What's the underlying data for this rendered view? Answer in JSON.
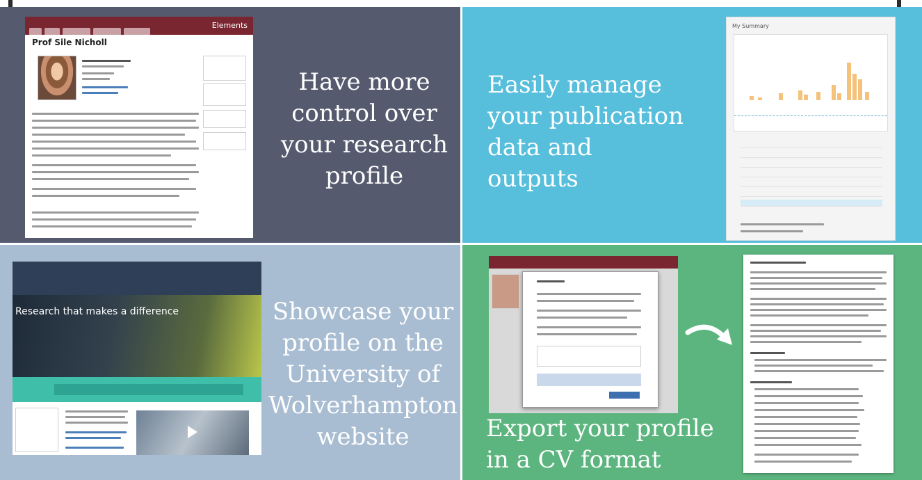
{
  "panels": {
    "control": {
      "caption": [
        "Have more",
        "control over",
        "your research",
        "profile"
      ],
      "screenshot": {
        "brand": "Elements",
        "profile_name": "Prof Sile Nicholl"
      }
    },
    "manage": {
      "caption": [
        "Easily manage",
        "your publication",
        "data and",
        "outputs"
      ],
      "screenshot": {
        "title": "My Summary"
      }
    },
    "showcase": {
      "caption": [
        "Showcase your",
        "profile on the",
        "University of",
        "Wolverhampton",
        "website"
      ],
      "screenshot": {
        "hero_text": "Research that makes a difference"
      }
    },
    "export": {
      "caption": [
        "Export your profile",
        "in a CV format"
      ]
    }
  },
  "colors": {
    "control": "#555a6e",
    "manage": "#57bedb",
    "showcase": "#a9bdd2",
    "export": "#5cb57f"
  }
}
